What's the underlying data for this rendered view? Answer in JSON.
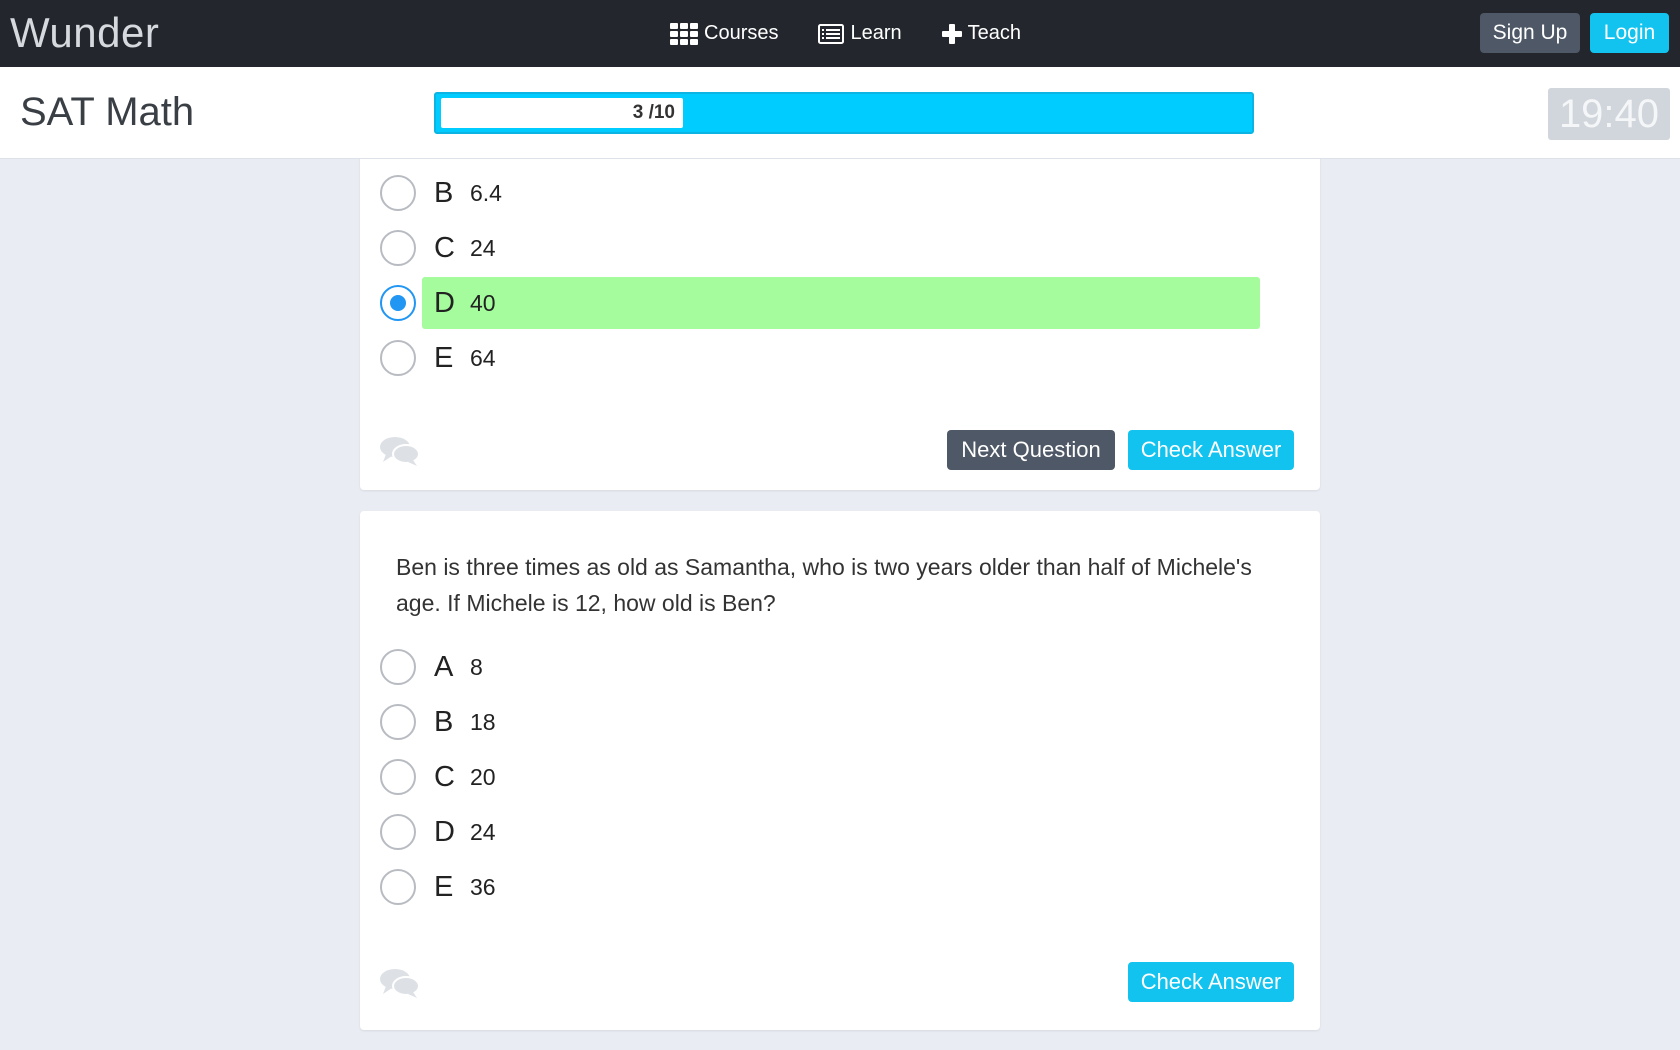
{
  "nav": {
    "brand": "Wunder",
    "links": [
      {
        "label": "Courses",
        "icon": "grid-icon"
      },
      {
        "label": "Learn",
        "icon": "list-icon"
      },
      {
        "label": "Teach",
        "icon": "plus-icon"
      }
    ],
    "signup_label": "Sign Up",
    "login_label": "Login"
  },
  "course": {
    "title": "SAT Math",
    "progress_label": "3 /10",
    "progress_fraction": 0.3,
    "timer": "19:40"
  },
  "colors": {
    "nav_bg": "#23272d",
    "accent": "#12c3ef",
    "progress_bar": "#00ccff",
    "secondary_button": "#4e5866",
    "selected_answer": "#a5fc9c",
    "radio_checked": "#2196f3",
    "page_bg": "#e9edf3"
  },
  "questions": [
    {
      "options": [
        {
          "letter": "B",
          "value": "6.4",
          "selected": false
        },
        {
          "letter": "C",
          "value": "24",
          "selected": false
        },
        {
          "letter": "D",
          "value": "40",
          "selected": true
        },
        {
          "letter": "E",
          "value": "64",
          "selected": false
        }
      ],
      "next_label": "Next Question",
      "check_label": "Check Answer",
      "comment_icon": "chat-bubbles-icon"
    },
    {
      "text": "Ben is three times as old as Samantha, who is two years older than half of Michele's age. If Michele is 12, how old is Ben?",
      "options": [
        {
          "letter": "A",
          "value": "8",
          "selected": false
        },
        {
          "letter": "B",
          "value": "18",
          "selected": false
        },
        {
          "letter": "C",
          "value": "20",
          "selected": false
        },
        {
          "letter": "D",
          "value": "24",
          "selected": false
        },
        {
          "letter": "E",
          "value": "36",
          "selected": false
        }
      ],
      "check_label": "Check Answer",
      "comment_icon": "chat-bubbles-icon"
    }
  ]
}
